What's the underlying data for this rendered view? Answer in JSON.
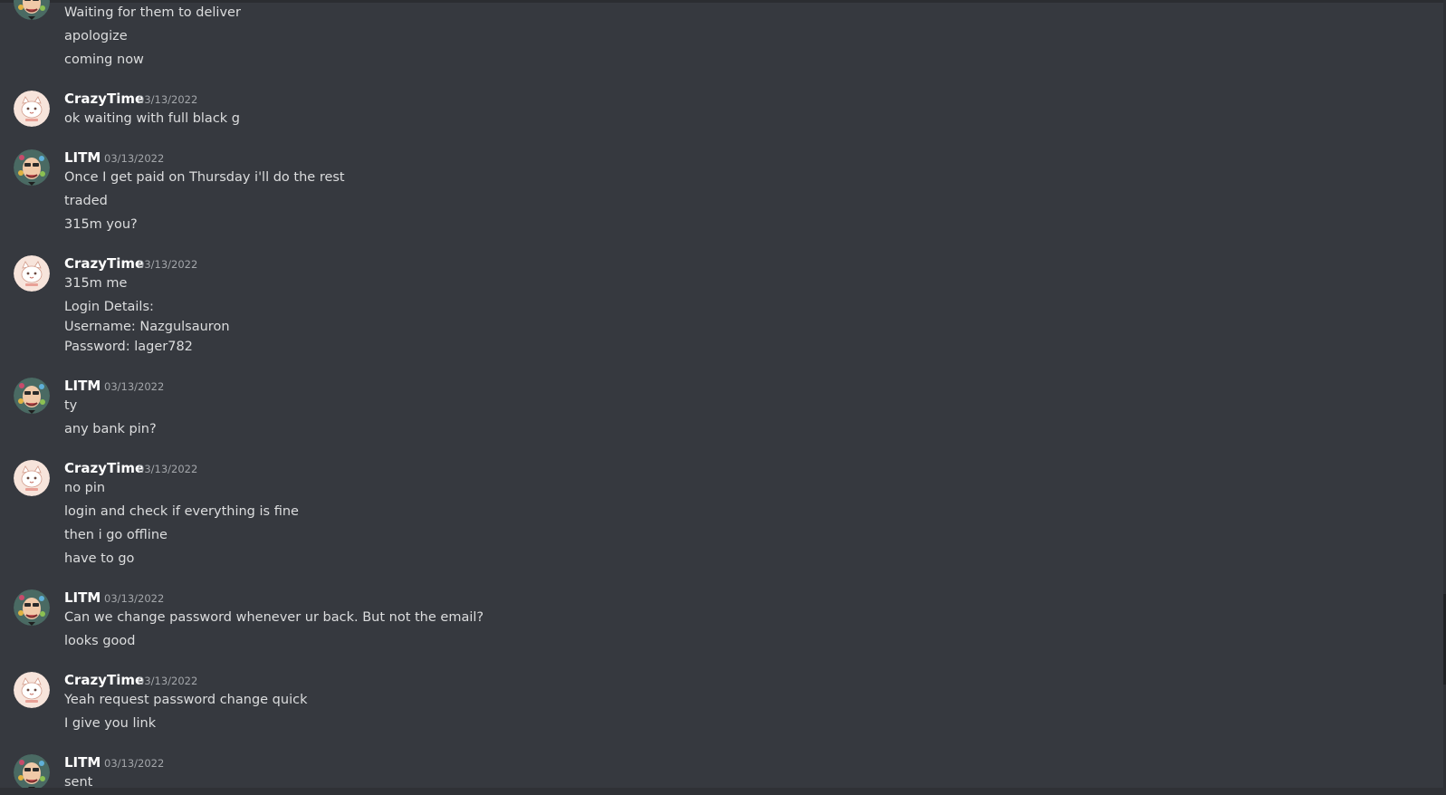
{
  "chat": {
    "intro_lines": [
      "Waiting for them to deliver",
      "apologize",
      "coming now"
    ],
    "groups": [
      {
        "author": "CrazyTime",
        "timestamp": "03/13/2022",
        "lines": [
          "ok waiting with full black g"
        ]
      },
      {
        "author": "LITM",
        "timestamp": "03/13/2022",
        "lines": [
          "Once I get paid on Thursday i'll do the rest",
          "traded",
          "315m you?"
        ]
      },
      {
        "author": "CrazyTime",
        "timestamp": "03/13/2022",
        "lines": [
          "315m me",
          "Login Details:",
          "Username: Nazgulsauron",
          "Password: lager782"
        ]
      },
      {
        "author": "LITM",
        "timestamp": "03/13/2022",
        "lines": [
          "ty",
          "any bank pin?"
        ]
      },
      {
        "author": "CrazyTime",
        "timestamp": "03/13/2022",
        "lines": [
          "no pin",
          "login and check if everything is fine",
          "then i go offline",
          "have to go"
        ]
      },
      {
        "author": "LITM",
        "timestamp": "03/13/2022",
        "lines": [
          "Can we change password whenever ur back. But not the email?",
          "looks good"
        ]
      },
      {
        "author": "CrazyTime",
        "timestamp": "03/13/2022",
        "lines": [
          "Yeah request password change quick",
          "I give you link"
        ]
      },
      {
        "author": "LITM",
        "timestamp": "03/13/2022",
        "lines": [
          "sent"
        ]
      }
    ]
  },
  "avatars": {
    "CrazyTime": {
      "icon": "cat-avatar-icon",
      "background": "#f7e4db"
    },
    "LITM": {
      "icon": "wizard-avatar-icon",
      "background": "#4a6a63"
    }
  },
  "colors": {
    "background": "#36393f",
    "username": "#ffffff",
    "message_text": "#dcddde",
    "timestamp": "#a3a6aa"
  }
}
